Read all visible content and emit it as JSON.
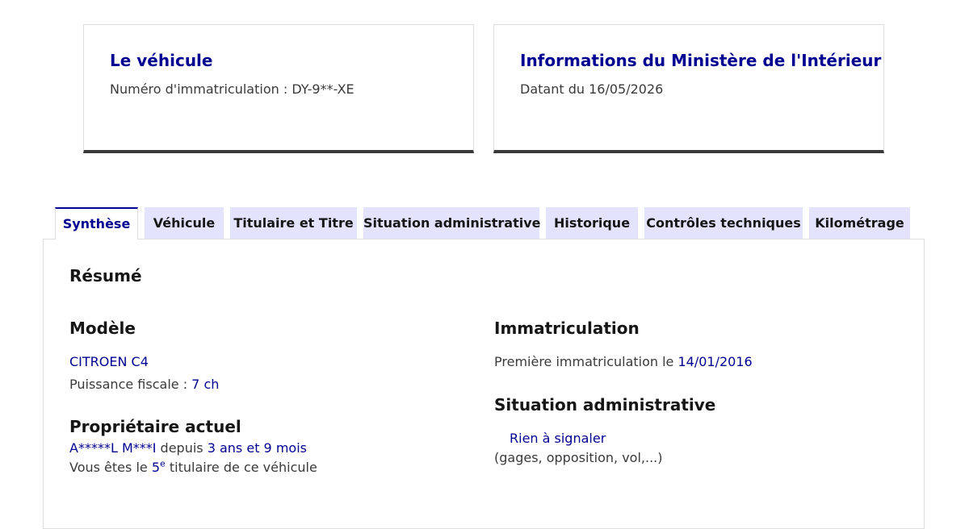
{
  "cards": {
    "vehicle": {
      "title": "Le véhicule",
      "subtitle": "Numéro d'immatriculation : DY-9**-XE"
    },
    "ministry": {
      "title": "Informations du Ministère de l'Intérieur",
      "subtitle": "Datant du 16/05/2026"
    }
  },
  "tabs": [
    {
      "label": "Synthèse",
      "active": true
    },
    {
      "label": "Véhicule"
    },
    {
      "label": "Titulaire et Titre"
    },
    {
      "label": "Situation administrative"
    },
    {
      "label": "Historique"
    },
    {
      "label": "Contrôles techniques"
    },
    {
      "label": "Kilométrage"
    }
  ],
  "summary": {
    "title": "Résumé",
    "model": {
      "heading": "Modèle",
      "name": "CITROEN C4",
      "power_label": "Puissance fiscale : ",
      "power_value": "7 ch"
    },
    "owner": {
      "heading": "Propriétaire actuel",
      "name": "A*****L M***I",
      "since_label": " depuis ",
      "since_value": "3 ans et 9 mois",
      "rank_prefix": "Vous êtes le ",
      "rank_number": "5",
      "rank_sup": "e",
      "rank_suffix": " titulaire de ce véhicule"
    },
    "registration": {
      "heading": "Immatriculation",
      "first_label": "Première immatriculation le ",
      "first_date": "14/01/2016"
    },
    "admin": {
      "heading": "Situation administrative",
      "status": "Rien à signaler",
      "details": "(gages, opposition, vol,...)"
    }
  },
  "colors": {
    "accent": "#000091",
    "tab_background": "#e3e3fd",
    "text": "#3a3a3a"
  }
}
